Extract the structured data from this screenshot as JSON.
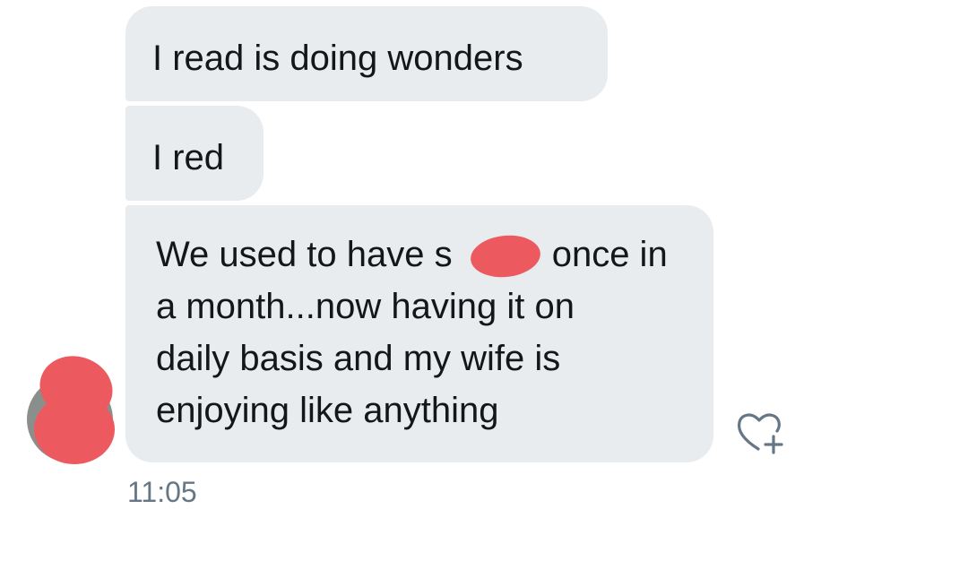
{
  "messages": [
    {
      "text": "I read is doing wonders"
    },
    {
      "text": "I red"
    },
    {
      "lines": [
        "We used to have s          once in",
        "a month...now having it on",
        "daily basis and my wife is",
        "enjoying like anything"
      ]
    }
  ],
  "timestamp": "11:05",
  "icons": {
    "reaction": "heart-plus-icon",
    "avatar": "avatar-redacted"
  },
  "colors": {
    "bubble": "#e9ecef",
    "text": "#14171a",
    "timestamp": "#657786",
    "redaction": "#ec5a5f"
  }
}
